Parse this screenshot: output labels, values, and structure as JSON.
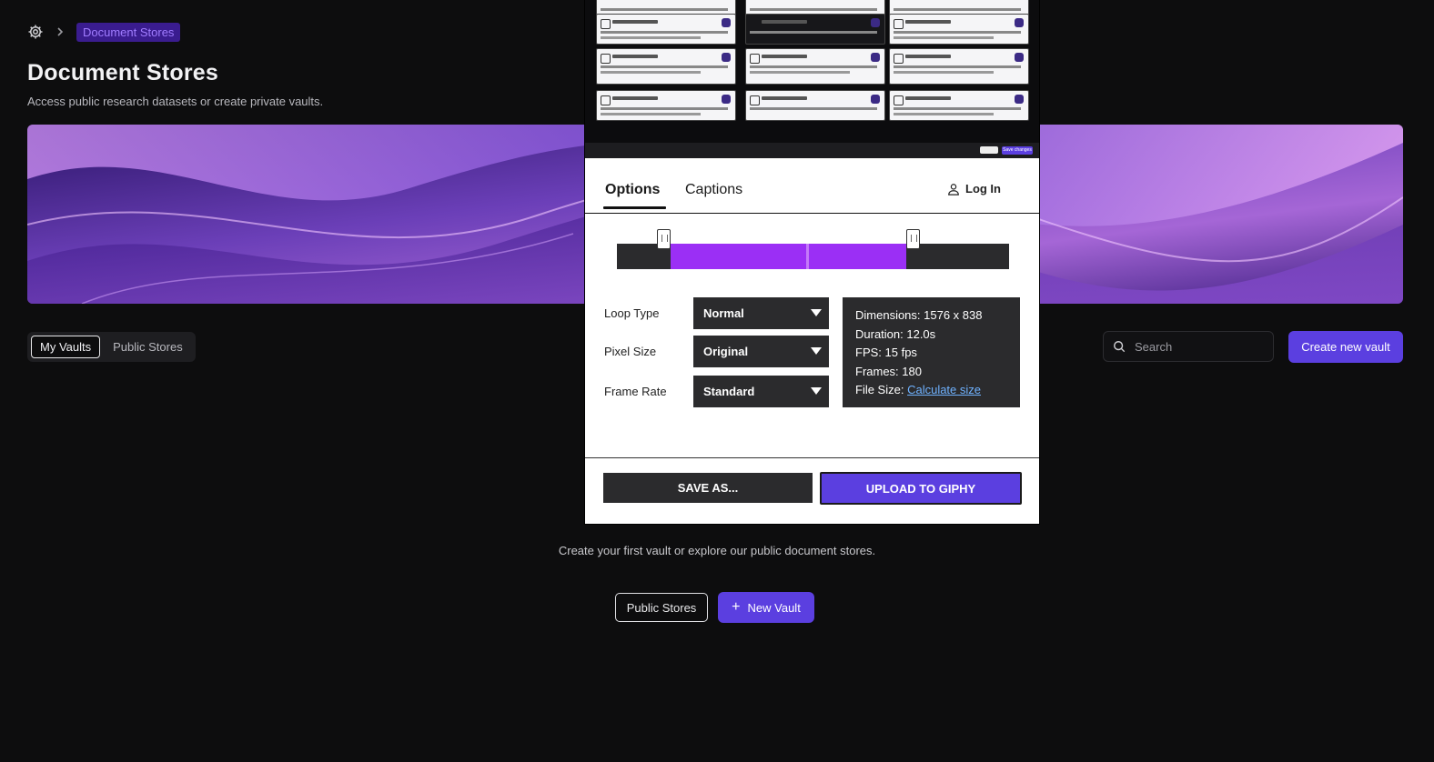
{
  "breadcrumb": {
    "current": "Document Stores"
  },
  "page": {
    "title": "Document Stores",
    "subtitle": "Access public research datasets or create private vaults."
  },
  "tabs": {
    "my_vaults": "My Vaults",
    "public_stores": "Public Stores"
  },
  "search": {
    "placeholder": "Search"
  },
  "buttons": {
    "create_new_vault": "Create new vault",
    "public_stores": "Public Stores",
    "new_vault": "New Vault"
  },
  "empty_state": {
    "message": "Create your first vault or explore our public document stores."
  },
  "recorder": {
    "tabs": {
      "options": "Options",
      "captions": "Captions"
    },
    "login": "Log In",
    "options": {
      "loop_type": {
        "label": "Loop Type",
        "value": "Normal"
      },
      "pixel_size": {
        "label": "Pixel Size",
        "value": "Original"
      },
      "frame_rate": {
        "label": "Frame Rate",
        "value": "Standard"
      }
    },
    "info": {
      "dimensions": "Dimensions: 1576 x 838",
      "duration": "Duration: 12.0s",
      "fps": "FPS: 15 fps",
      "frames": "Frames: 180",
      "file_size_label": "File Size: ",
      "file_size_link": "Calculate size"
    },
    "save_as": "SAVE AS...",
    "upload": "UPLOAD TO GIPHY",
    "preview": {
      "save_changes": "Save changes"
    }
  },
  "colors": {
    "accent": "#5b3fe0",
    "background": "#0d0d0e",
    "timeline_selection": "#9b2ff5",
    "link": "#6fb2ff"
  },
  "icons": {
    "home": "gear-icon",
    "breadcrumb_separator": "chevron-right-icon",
    "search": "search-icon",
    "user": "user-icon",
    "plus": "plus-icon",
    "dropdown": "caret-down-icon"
  }
}
